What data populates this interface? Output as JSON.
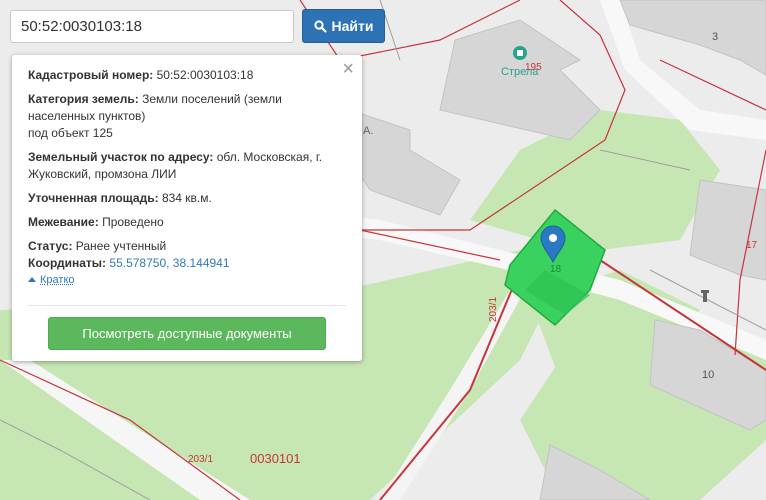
{
  "search": {
    "value": "50:52:0030103:18",
    "button_label": "Найти"
  },
  "popup": {
    "cadastral_label": "Кадастровый номер:",
    "cadastral_value": "50:52:0030103:18",
    "category_label": "Категория земель:",
    "category_value": "Земли поселений (земли населенных пунктов)",
    "category_extra": "под объект 125",
    "address_label": "Земельный участок по адресу:",
    "address_value": "обл. Московская, г. Жуковский, промзона ЛИИ",
    "area_label": "Уточненная площадь:",
    "area_value": "834 кв.м.",
    "survey_label": "Межевание:",
    "survey_value": "Проведено",
    "status_label": "Статус:",
    "status_value": "Ранее учтенный",
    "coords_label": "Координаты:",
    "coords_value": "55.578750, 38.144941",
    "toggle_label": "Кратко",
    "docs_button": "Посмотреть доступные документы",
    "close_icon": "close-icon"
  },
  "map": {
    "labels": {
      "number_3": "3",
      "number_195": "195",
      "poi_strela": "Стрела",
      "number_17": "17",
      "parcel_18": "18",
      "number_10": "10",
      "label_2031_vertical": "203/1",
      "label_2031_bottom": "203/1",
      "quarter_0030101": "0030101",
      "poi_a_fragment": "А."
    },
    "colors": {
      "background": "#ececec",
      "green": "#c6e6b3",
      "road": "#ffffff",
      "building": "#d7d7d7",
      "parcel_line": "#c8343b",
      "selected_parcel": "#3ad25e",
      "marker": "#2a79c4"
    }
  }
}
